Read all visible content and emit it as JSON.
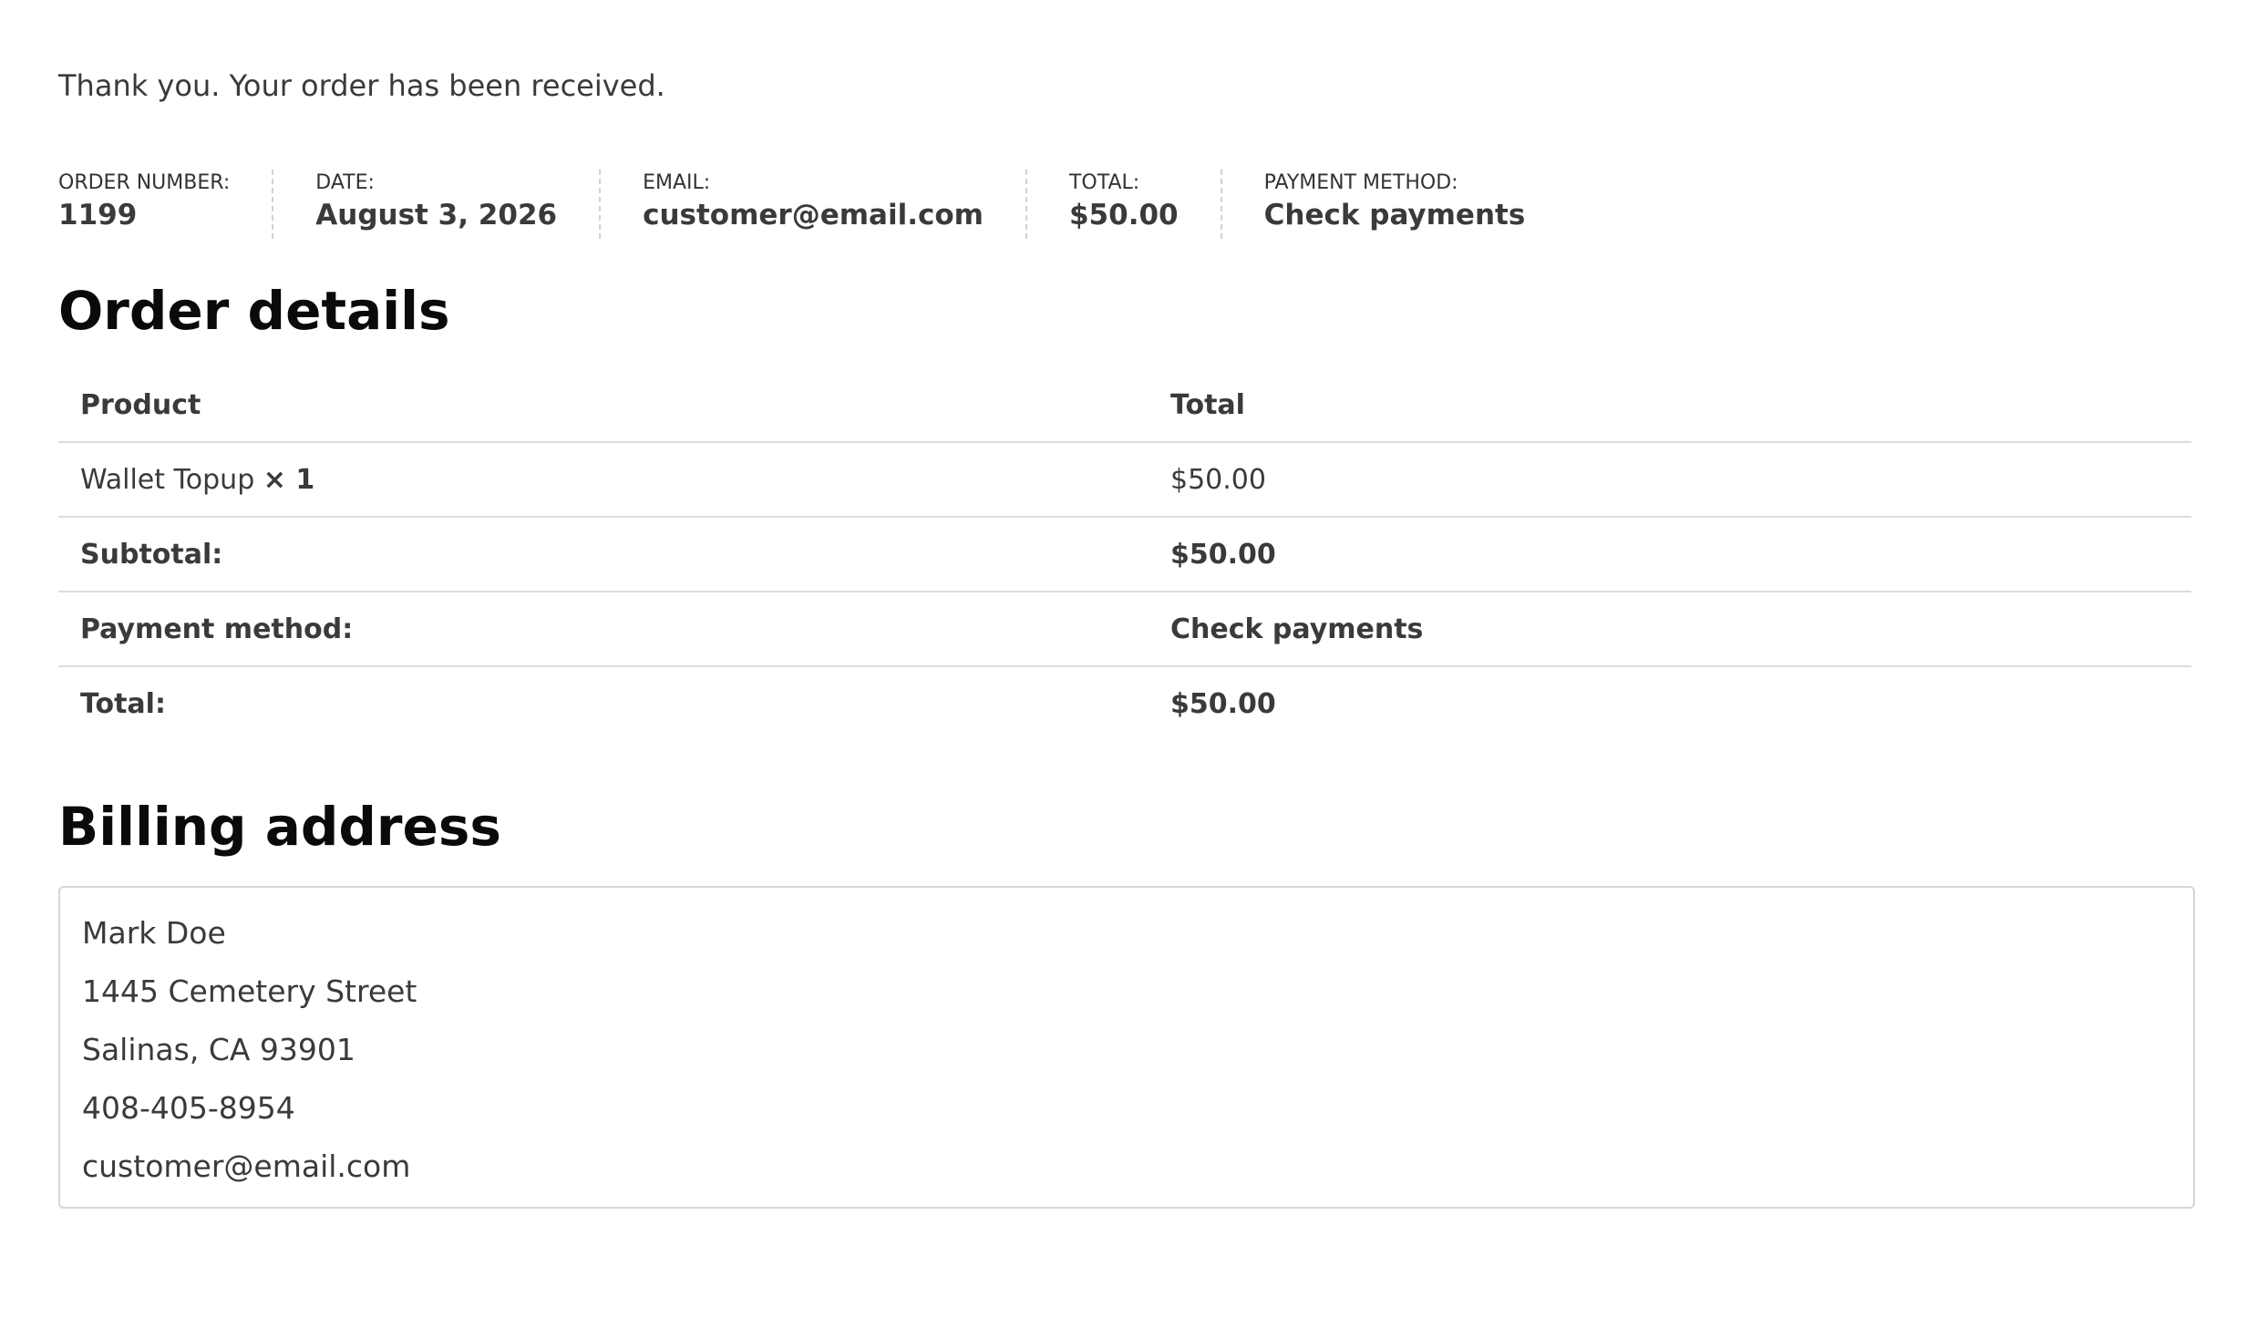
{
  "notice": "Thank you. Your order has been received.",
  "overview": [
    {
      "key": "order",
      "label": "ORDER NUMBER:",
      "value": "1199"
    },
    {
      "key": "date",
      "label": "DATE:",
      "value": "August 3, 2026"
    },
    {
      "key": "email",
      "label": "EMAIL:",
      "value": "customer@email.com"
    },
    {
      "key": "total",
      "label": "TOTAL:",
      "value": "$50.00"
    },
    {
      "key": "method",
      "label": "PAYMENT METHOD:",
      "value": "Check payments"
    }
  ],
  "order_details": {
    "title": "Order details",
    "columns": [
      "Product",
      "Total"
    ],
    "items": [
      {
        "name": "Wallet Topup",
        "quantity": "× 1",
        "total": "$50.00"
      }
    ],
    "totals": [
      {
        "label": "Subtotal:",
        "value": "$50.00"
      },
      {
        "label": "Payment method:",
        "value": "Check payments"
      },
      {
        "label": "Total:",
        "value": "$50.00"
      }
    ]
  },
  "billing": {
    "title": "Billing address",
    "name": "Mark Doe",
    "street": "1445 Cemetery Street",
    "city_line": "Salinas, CA 93901",
    "phone": "408-405-8954",
    "email": "customer@email.com"
  }
}
